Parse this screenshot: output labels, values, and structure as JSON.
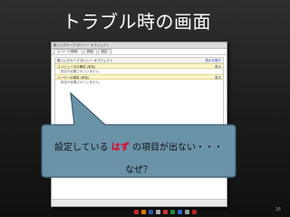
{
  "slide": {
    "title": "トラブル時の画面",
    "page_number": "16"
  },
  "app_window": {
    "title": "新しいグループ ポリシー オブジェクト",
    "tabs": [
      {
        "label": "スコープ(範囲)"
      },
      {
        "label": "詳細"
      },
      {
        "label": "設定"
      }
    ],
    "panel_header": {
      "label": "新しいグループ ポリシー オブジェクト",
      "right": "表示を隠す"
    },
    "rows": [
      {
        "label": "コンピュータの構成 (有効)",
        "right": "表示"
      },
      {
        "label": "設定が定義されていません。",
        "right": ""
      },
      {
        "label": "ユーザーの構成 (有効)",
        "right": "表示"
      },
      {
        "label": "設定が定義されていません。",
        "right": ""
      }
    ]
  },
  "callout": {
    "text_before": "設定している",
    "text_highlight": "はず",
    "text_after": "の項目が出ない・・・",
    "line2": "なぜ？"
  },
  "colors": {
    "callout_fill": "#6b93a8",
    "callout_border": "#3a5a6f",
    "highlight": "#e0002a"
  },
  "taskbar_icons": [
    {
      "name": "app-icon-1",
      "color": "#cc2222"
    },
    {
      "name": "app-icon-2",
      "color": "#dd7700"
    },
    {
      "name": "app-icon-3",
      "color": "#3355aa"
    },
    {
      "name": "app-icon-4",
      "color": "#aaaaaa"
    },
    {
      "name": "app-icon-5",
      "color": "#cc3333"
    },
    {
      "name": "app-icon-6",
      "color": "#228833"
    },
    {
      "name": "app-icon-7",
      "color": "#3366cc"
    },
    {
      "name": "app-icon-8",
      "color": "#999999"
    },
    {
      "name": "app-icon-9",
      "color": "#bb2222"
    }
  ]
}
